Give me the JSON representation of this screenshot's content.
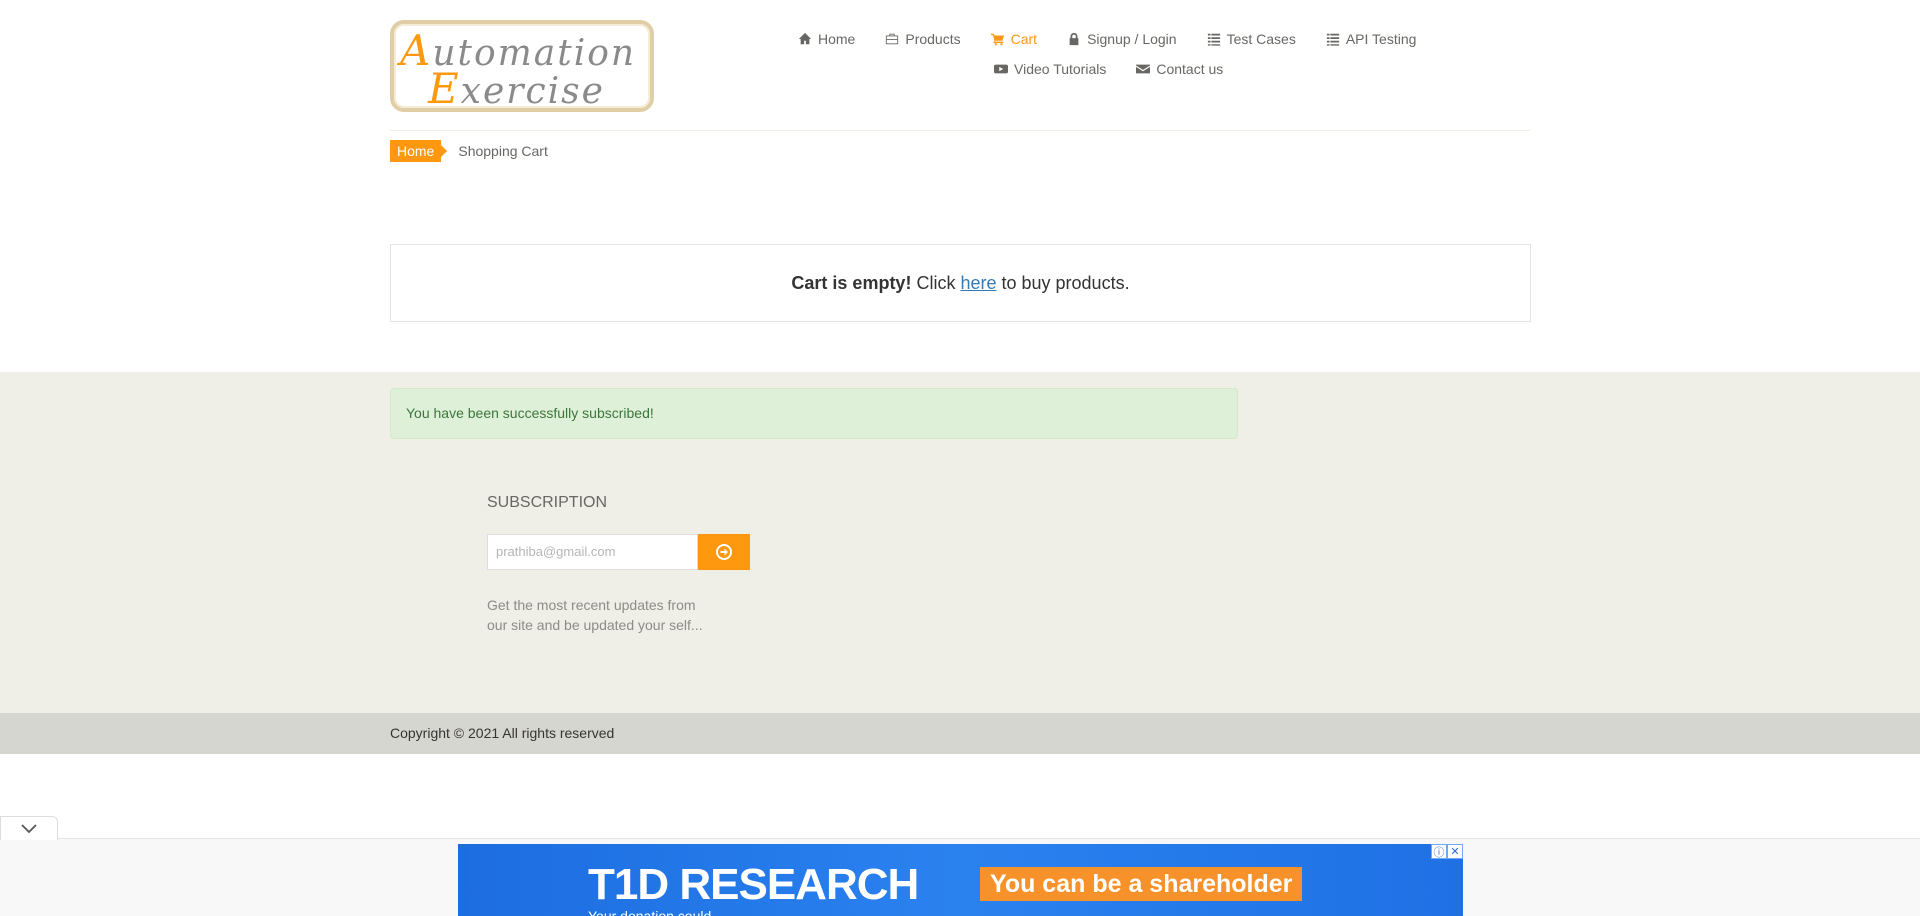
{
  "logo": {
    "line1": "Automation",
    "line2": "Exercise"
  },
  "nav": {
    "row1": [
      {
        "label": "Home",
        "icon": "home-icon"
      },
      {
        "label": "Products",
        "icon": "briefcase-icon"
      },
      {
        "label": "Cart",
        "icon": "shopping-cart-icon",
        "active": true
      },
      {
        "label": "Signup / Login",
        "icon": "lock-icon"
      },
      {
        "label": "Test Cases",
        "icon": "list-icon"
      },
      {
        "label": "API Testing",
        "icon": "list-icon"
      }
    ],
    "row2": [
      {
        "label": "Video Tutorials",
        "icon": "youtube-play-icon"
      },
      {
        "label": "Contact us",
        "icon": "envelope-icon"
      }
    ]
  },
  "breadcrumb": {
    "home": "Home",
    "current": "Shopping Cart"
  },
  "cart": {
    "empty_bold": "Cart is empty!",
    "click": "Click",
    "link": "here",
    "rest": "to buy products."
  },
  "footer": {
    "alert": "You have been successfully subscribed!",
    "subscription_title": "SUBSCRIPTION",
    "email_value": "prathiba@gmail.com",
    "description": "Get the most recent updates from our site and be updated your self...",
    "copyright": "Copyright © 2021 All rights reserved"
  },
  "ad": {
    "title": "T1D RESEARCH",
    "cta": "You can be a shareholder",
    "subtext": "Your donation could..."
  },
  "colors": {
    "accent": "#fe980f",
    "footer_bg": "#efeee7",
    "bottom_bar": "#d6d6d0",
    "alert_bg": "#dff0d8"
  }
}
